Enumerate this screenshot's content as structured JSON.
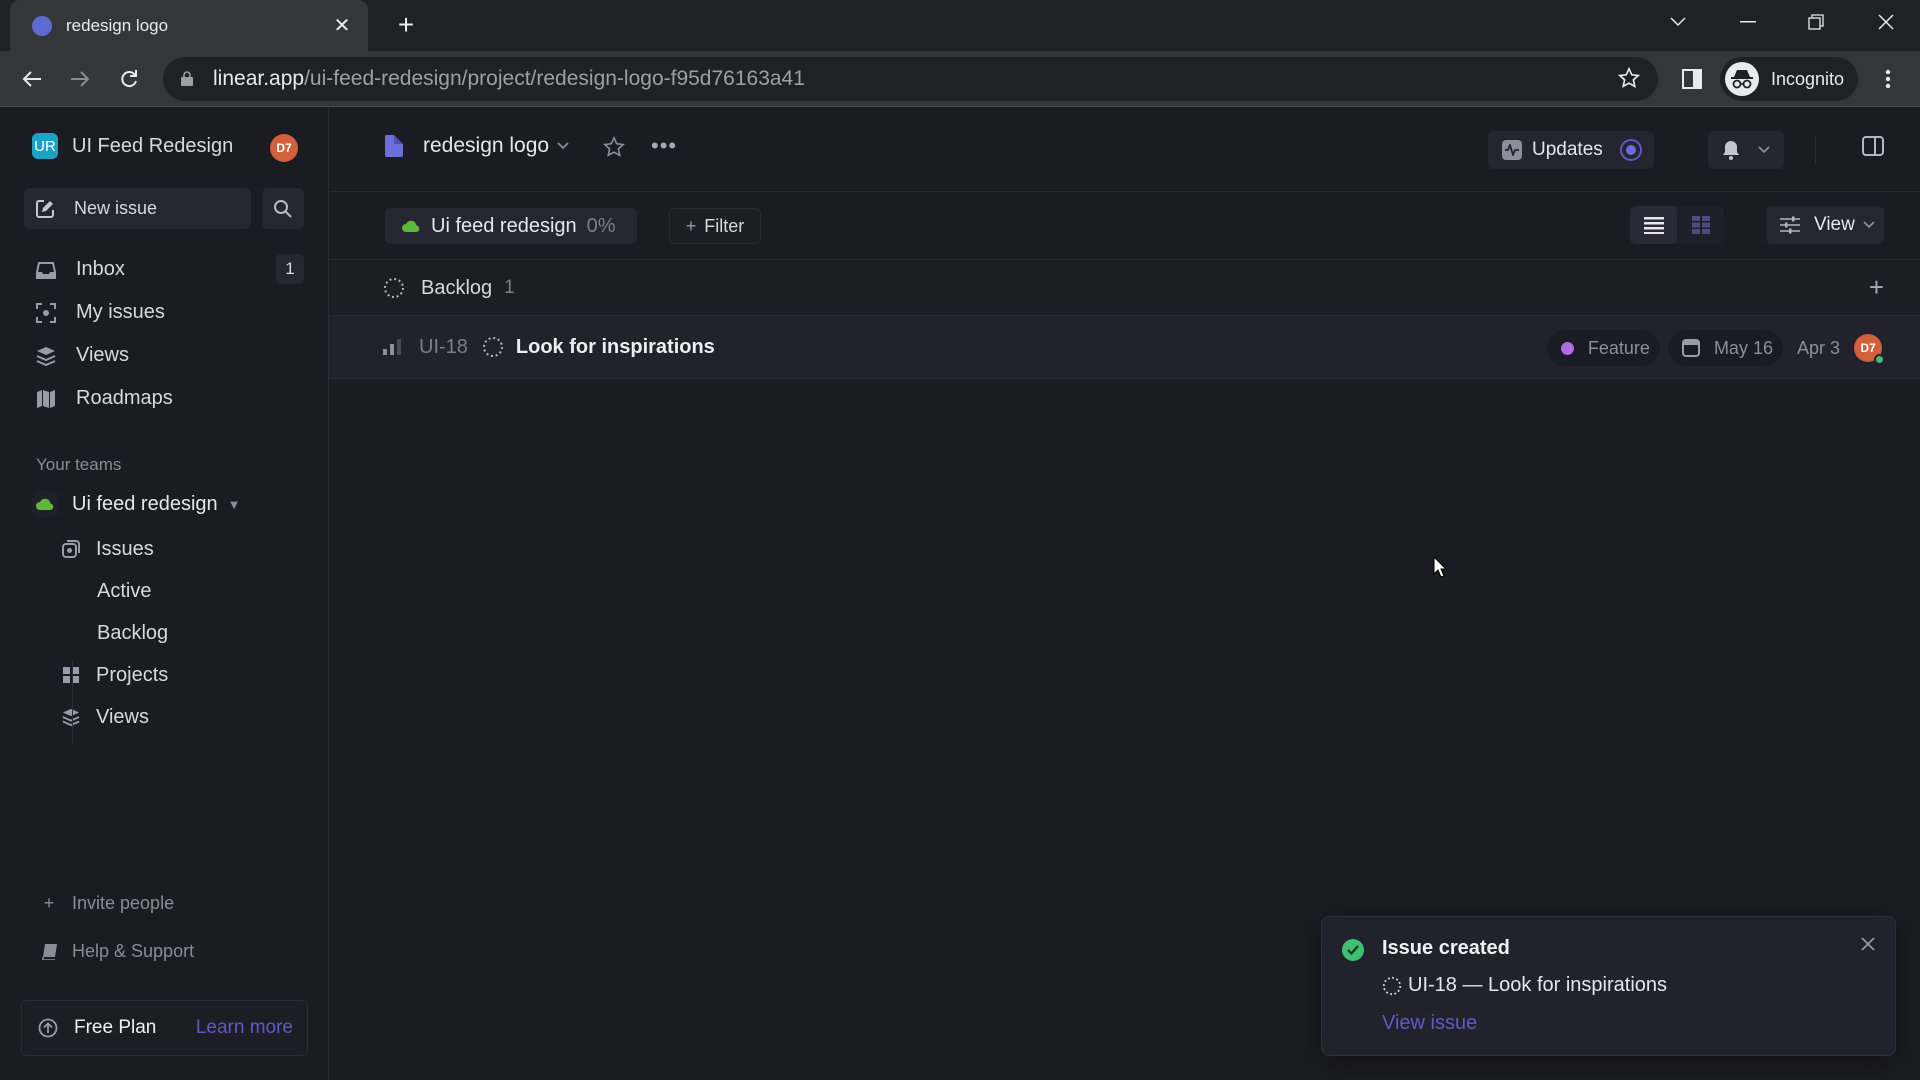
{
  "browser": {
    "tab_title": "redesign logo",
    "url_host": "linear.app",
    "url_path": "/ui-feed-redesign/project/redesign-logo-f95d76163a41",
    "profile_label": "Incognito"
  },
  "sidebar": {
    "workspace_initials": "UR",
    "workspace_name": "UI Feed Redesign",
    "user_initials": "D7",
    "new_issue_label": "New issue",
    "nav": [
      {
        "label": "Inbox",
        "icon": "inbox-icon",
        "badge": "1"
      },
      {
        "label": "My issues",
        "icon": "my-issues-icon"
      },
      {
        "label": "Views",
        "icon": "views-icon"
      },
      {
        "label": "Roadmaps",
        "icon": "roadmap-icon"
      }
    ],
    "teams_heading": "Your teams",
    "team_name": "Ui feed redesign",
    "team_items": [
      {
        "label": "Issues",
        "icon": "issues-icon"
      },
      {
        "label": "Active"
      },
      {
        "label": "Backlog"
      },
      {
        "label": "Projects",
        "icon": "projects-icon"
      },
      {
        "label": "Views",
        "icon": "views-icon"
      }
    ],
    "invite_label": "Invite people",
    "help_label": "Help & Support",
    "plan_label": "Free Plan",
    "plan_link": "Learn more"
  },
  "header": {
    "project_title": "redesign logo",
    "updates_label": "Updates"
  },
  "subheader": {
    "team_chip_name": "Ui feed redesign",
    "team_chip_progress": "0%",
    "filter_label": "Filter",
    "view_label": "View"
  },
  "groups": [
    {
      "label": "Backlog",
      "count": "1",
      "issues": [
        {
          "id": "UI-18",
          "title": "Look for inspirations",
          "label": "Feature",
          "label_color": "#b06be8",
          "due_date": "May 16",
          "created": "Apr 3",
          "assignee_initials": "D7"
        }
      ]
    }
  ],
  "toast": {
    "title": "Issue created",
    "issue_line": "UI-18 — Look for inspirations",
    "link_label": "View issue"
  },
  "colors": {
    "accent": "#5e6ad2",
    "link": "#5c5bc7",
    "team_green": "#5fb83a",
    "success": "#3fbf74",
    "avatar": "#d2603b"
  }
}
